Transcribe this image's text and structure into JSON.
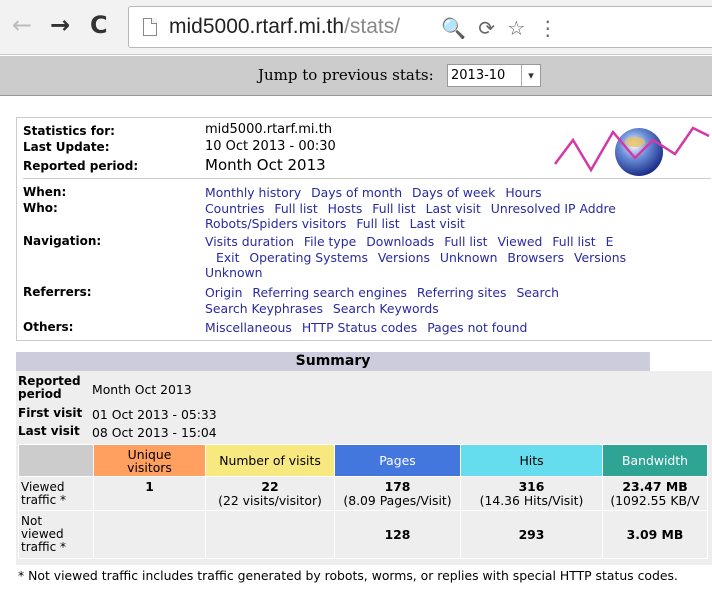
{
  "browser": {
    "url_host": "mid5000.rtarf.mi.th",
    "url_path": "/stats/",
    "back_glyph": "←",
    "forward_glyph": "→",
    "reload_glyph": "C",
    "zoom_glyph": "🔍",
    "ext_glyph": "⟳",
    "star_glyph": "☆",
    "more_glyph": "⋮"
  },
  "jump": {
    "label": "Jump to previous stats:",
    "selected": "2013-10",
    "arrow": "▾"
  },
  "info": {
    "stats_for_label": "Statistics for:",
    "stats_for_value": "mid5000.rtarf.mi.th",
    "last_update_label": "Last Update:",
    "last_update_value": "10 Oct 2013 - 00:30",
    "period_label": "Reported period:",
    "period_value": "Month Oct 2013",
    "when_label": "When:",
    "when_links": [
      "Monthly history",
      "Days of month",
      "Days of week",
      "Hours"
    ],
    "who_label": "Who:",
    "who_links_1": [
      "Countries",
      "Full list",
      "Hosts",
      "Full list",
      "Last visit",
      "Unresolved IP Addre"
    ],
    "who_links_2": [
      "Robots/Spiders visitors",
      "Full list",
      "Last visit"
    ],
    "nav_label": "Navigation:",
    "nav_links_1": [
      "Visits duration",
      "File type",
      "Downloads",
      "Full list",
      "Viewed",
      "Full list",
      "E"
    ],
    "nav_links_2": [
      "Exit",
      "Operating Systems",
      "Versions",
      "Unknown",
      "Browsers",
      "Versions"
    ],
    "nav_links_3": [
      "Unknown"
    ],
    "ref_label": "Referrers:",
    "ref_links_1": [
      "Origin",
      "Referring search engines",
      "Referring sites",
      "Search"
    ],
    "ref_links_2": [
      "Search Keyphrases",
      "Search Keywords"
    ],
    "others_label": "Others:",
    "others_links": [
      "Miscellaneous",
      "HTTP Status codes",
      "Pages not found"
    ]
  },
  "summary": {
    "title": "Summary",
    "period_label_1": "Reported",
    "period_label_2": "period",
    "period_value": "Month Oct 2013",
    "first_visit_label": "First visit",
    "first_visit_value": "01 Oct 2013 - 05:33",
    "last_visit_label": "Last visit",
    "last_visit_value": "08 Oct 2013 - 15:04",
    "headers": [
      {
        "label_1": "Unique",
        "label_2": "visitors",
        "color": "#ffa060"
      },
      {
        "label_1": "Number of visits",
        "label_2": "",
        "color": "#f8e880"
      },
      {
        "label_1": "Pages",
        "label_2": "",
        "color": "#4477dd"
      },
      {
        "label_1": "Hits",
        "label_2": "",
        "color": "#66ddee"
      },
      {
        "label_1": "Bandwidth",
        "label_2": "",
        "color": "#2ea495"
      }
    ],
    "viewed_label_1": "Viewed",
    "viewed_label_2": "traffic *",
    "viewed": {
      "unique": "1",
      "visits": "22",
      "visits_sub": "(22 visits/visitor)",
      "pages": "178",
      "pages_sub": "(8.09 Pages/Visit)",
      "hits": "316",
      "hits_sub": "(14.36 Hits/Visit)",
      "bandwidth": "23.47 MB",
      "bandwidth_sub": "(1092.55 KB/V"
    },
    "notviewed_label_1": "Not",
    "notviewed_label_2": "viewed",
    "notviewed_label_3": "traffic *",
    "notviewed": {
      "pages": "128",
      "hits": "293",
      "bandwidth": "3.09 MB"
    },
    "footnote": "* Not viewed traffic includes traffic generated by robots, worms, or replies with special HTTP status codes."
  }
}
